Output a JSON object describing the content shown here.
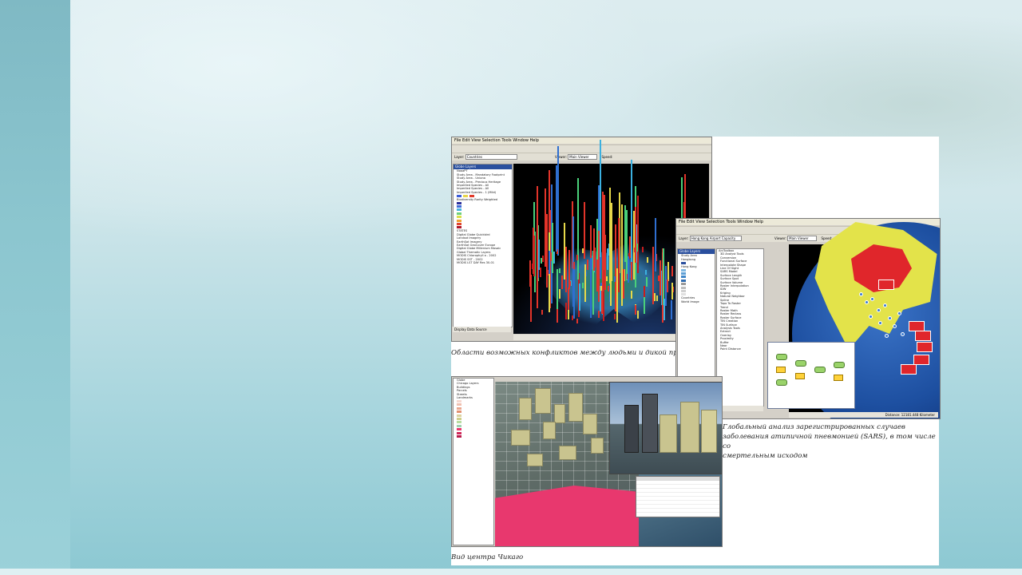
{
  "collage": {
    "top_left_screenshot": {
      "menu": "File  Edit  View  Selection  Tools  Window  Help",
      "layer_label": "Layer:",
      "layer_value": "Countries",
      "viewer_label": "Viewer:",
      "viewer_value": "Main Viewer",
      "speed_label": "Speed:",
      "animation_label": "Animation",
      "toc_title": "Globe Layers",
      "toc_items": [
        "NoaaPT",
        "Study Area - Mandatory Footprint",
        "Study Area - Uniona",
        "Study Area - Precious Heritage",
        "Imperiled Species - All",
        "Imperiled Species - All",
        "Imperiled Species - 1 (Mild)",
        "Biodiversity Rarity Weighted",
        "STATES",
        "Digital Globe Quickbird",
        "Landsat Imagery",
        "EarthSat Imagery",
        "EarthSat GeoCover Europe",
        "Digital Globe Millenium Mosaic",
        "Global Thematic Layers",
        "MODIS Chlorophyll a - 2002",
        "MODIS SST - 2002",
        "MODIS LST DAY Res 30-01"
      ],
      "tabs": "Display   Data   Source"
    },
    "caption_top": "Области возможных конфликтов между людьми и дикой природой",
    "right_screenshot": {
      "menu": "File  Edit  View  Selection  Tools  Window  Help",
      "layer_label": "Layer:",
      "layer_value": "Hong Kong Airport Capacity",
      "viewer_label": "Viewer:",
      "viewer_value": "Main Viewer",
      "speed_label": "Speed:",
      "animation_label": "Animation",
      "toc_title": "Globe Layers",
      "toc_items": [
        "Study Area",
        "Hongkong",
        "Hong Kong",
        "Countries",
        "World Image"
      ],
      "toolbox_title": "ArcToolbox",
      "toolbox_items": [
        "3D Analyst Tools",
        "Conversion",
        "Functional Surface",
        "Interpolate Shape",
        "Line Of Sight",
        "SARS Model",
        "Surface Length",
        "Surface Spot",
        "Surface Volume",
        "Raster Interpolation",
        "IDW",
        "Kriging",
        "Natural Neighbor",
        "Spline",
        "Topo To Raster",
        "Trend",
        "Raster Math",
        "Raster Reclass",
        "Raster Surface",
        "TIN Creation",
        "TIN Surface",
        "Analysis Tools",
        "Extract",
        "Overlay",
        "Proximity",
        "Buffer",
        "Near",
        "Point Distance"
      ],
      "tabs": "Display   Type   Index   Search",
      "status": "Distance: 12181.448 Kilometer"
    },
    "caption_right": [
      "Глобальный анализ зарегистрированных случаев",
      "заболевания атипичной пневмонией (SARS), в том числе со",
      "смертельным исходом"
    ],
    "bottom_screenshot": {
      "toc_items": [
        "Globe",
        "Chicago Layers",
        "Buildings",
        "Parcels",
        "Streets",
        "Landmarks"
      ]
    },
    "caption_bottom": "Вид центра Чикаго"
  },
  "colors": {
    "accent_red": "#e0262b",
    "land_yellow": "#e3e34a",
    "pink_parcels": "#e8386e",
    "toc_header": "#2a4f9e"
  }
}
